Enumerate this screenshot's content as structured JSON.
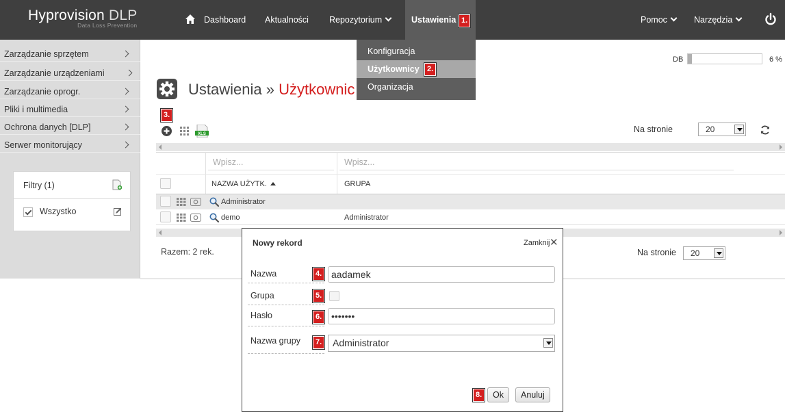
{
  "brand": {
    "name_bold": "Hyprovision",
    "name_thin": " DLP",
    "subtitle": "Data Loss Prevention"
  },
  "nav": {
    "items": [
      {
        "label": "Dashboard"
      },
      {
        "label": "Aktualności"
      },
      {
        "label": "Repozytorium"
      },
      {
        "label": "Ustawienia"
      }
    ],
    "right": [
      {
        "label": "Pomoc"
      },
      {
        "label": "Narzędzia"
      }
    ]
  },
  "dropdown": {
    "items": [
      {
        "label": "Konfiguracja"
      },
      {
        "label": "Użytkownicy"
      },
      {
        "label": "Organizacja"
      }
    ]
  },
  "markers": [
    "1.",
    "2.",
    "3.",
    "4.",
    "5.",
    "6.",
    "7.",
    "8."
  ],
  "sidebar": {
    "items": [
      {
        "label": "Zarządzanie sprzętem"
      },
      {
        "label": "Zarządzanie urządzeniami"
      },
      {
        "label": "Zarządzanie oprogr."
      },
      {
        "label": "Pliki i multimedia"
      },
      {
        "label": "Ochrona danych [DLP]"
      },
      {
        "label": "Serwer monitorujący"
      }
    ],
    "filters": {
      "header": "Filtry (1)",
      "item": "Wszystko"
    }
  },
  "db": {
    "label": "DB",
    "percent_text": "6 %",
    "fill_fraction": 0.06
  },
  "page": {
    "title_prefix": "Ustawienia » ",
    "title_highlight": "Użytkownic"
  },
  "toolbar": {
    "per_page_label": "Na stronie",
    "per_page_value": "20"
  },
  "table": {
    "filter_placeholders": [
      "Wpisz...",
      "Wpisz..."
    ],
    "headers": {
      "name": "NAZWA UŻYTK.",
      "group": "GRUPA"
    },
    "rows": [
      {
        "name": "Administrator",
        "group": ""
      },
      {
        "name": "demo",
        "group": "Administrator"
      }
    ],
    "total": "Razem: 2 rek."
  },
  "modal": {
    "title": "Nowy rekord",
    "close_label": "Zamknij",
    "fields": {
      "name_label": "Nazwa",
      "name_value": "aadamek",
      "group_label": "Grupa",
      "password_label": "Hasło",
      "password_value": "•••••••",
      "group_name_label": "Nazwa grupy",
      "group_name_value": "Administrator"
    },
    "ok_label": "Ok",
    "cancel_label": "Anuluj"
  },
  "colors": {
    "accent": "#d41f1f",
    "topbar": "#3f3f3f",
    "sidebar": "#dcdcdc"
  }
}
